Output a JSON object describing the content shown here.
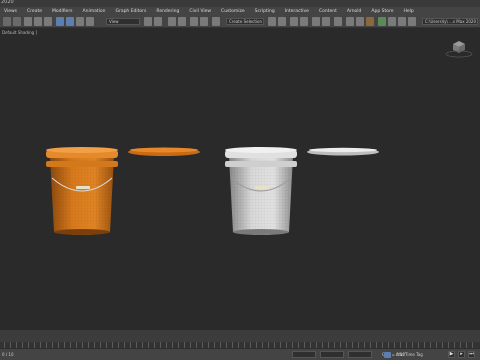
{
  "window": {
    "title": "2020"
  },
  "menu": {
    "items": [
      "Views",
      "Create",
      "Modifiers",
      "Animation",
      "Graph Editors",
      "Rendering",
      "Civil View",
      "Customize",
      "Scripting",
      "Interactive",
      "Content",
      "Arnold",
      "App Store",
      "Help"
    ]
  },
  "toolbar": {
    "filter_dropdown": "View",
    "selection_set": "Create Selection Se",
    "workspace": "C:\\Users\\ly\\ ...s Max 2020"
  },
  "viewport": {
    "label": "Default Shading ]"
  },
  "status": {
    "left": "0 / 10",
    "grid": "Grid = 0'10\"",
    "add_time_tag": "Add Time Tag"
  },
  "colors": {
    "orange_bucket": "#d8741a",
    "white_bucket": "#c8c8c8"
  }
}
